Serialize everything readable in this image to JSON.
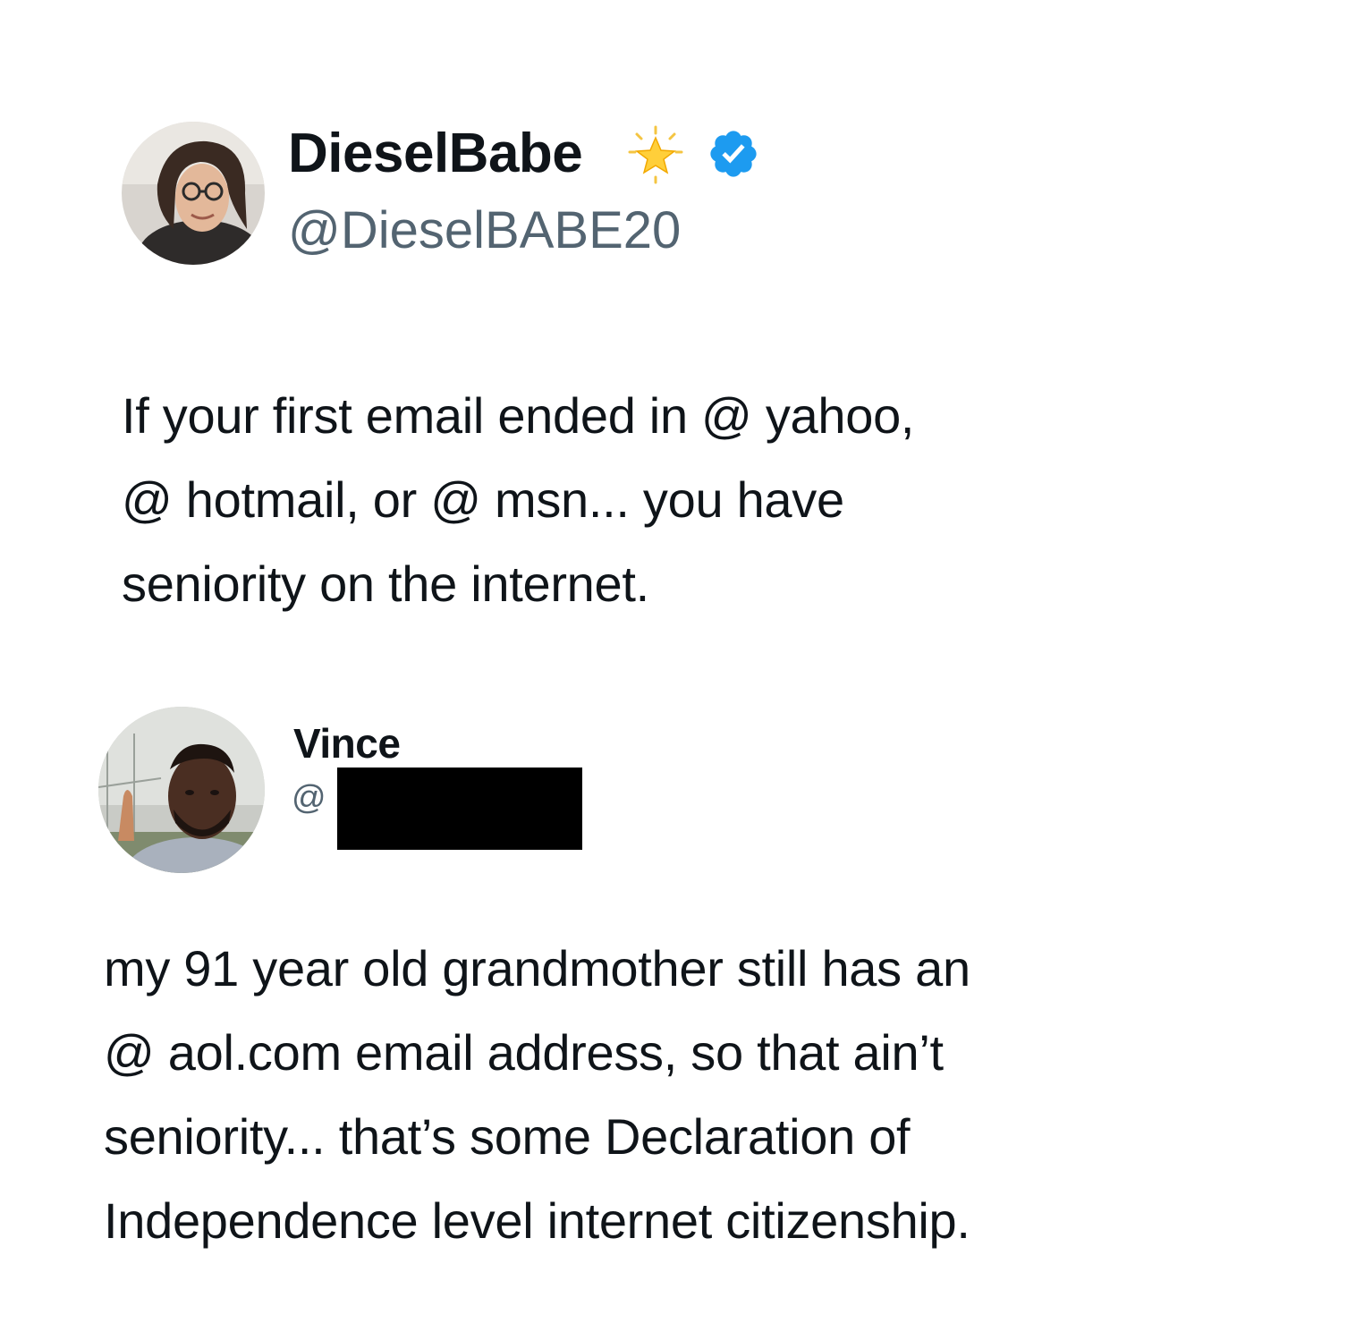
{
  "tweet": {
    "author": {
      "display_name": "DieselBabe",
      "handle": "@DieselBABE20",
      "badges": [
        "star-emoji-icon",
        "verified-badge-icon"
      ],
      "verified_color": "#1d9bf0"
    },
    "text_lines": [
      "If your first email ended in @ yahoo,",
      "@ hotmail, or @ msn... you have",
      "seniority on the internet."
    ]
  },
  "reply": {
    "author": {
      "display_name": "Vince",
      "handle": "@"
    },
    "text_lines": [
      "my 91 year old grandmother still has an",
      "@ aol.com email address, so that ain’t",
      "seniority... that’s some Declaration of",
      "Independence level internet citizenship."
    ]
  },
  "colors": {
    "text": "#0f1419",
    "secondary_text": "#536471",
    "background": "#ffffff"
  }
}
